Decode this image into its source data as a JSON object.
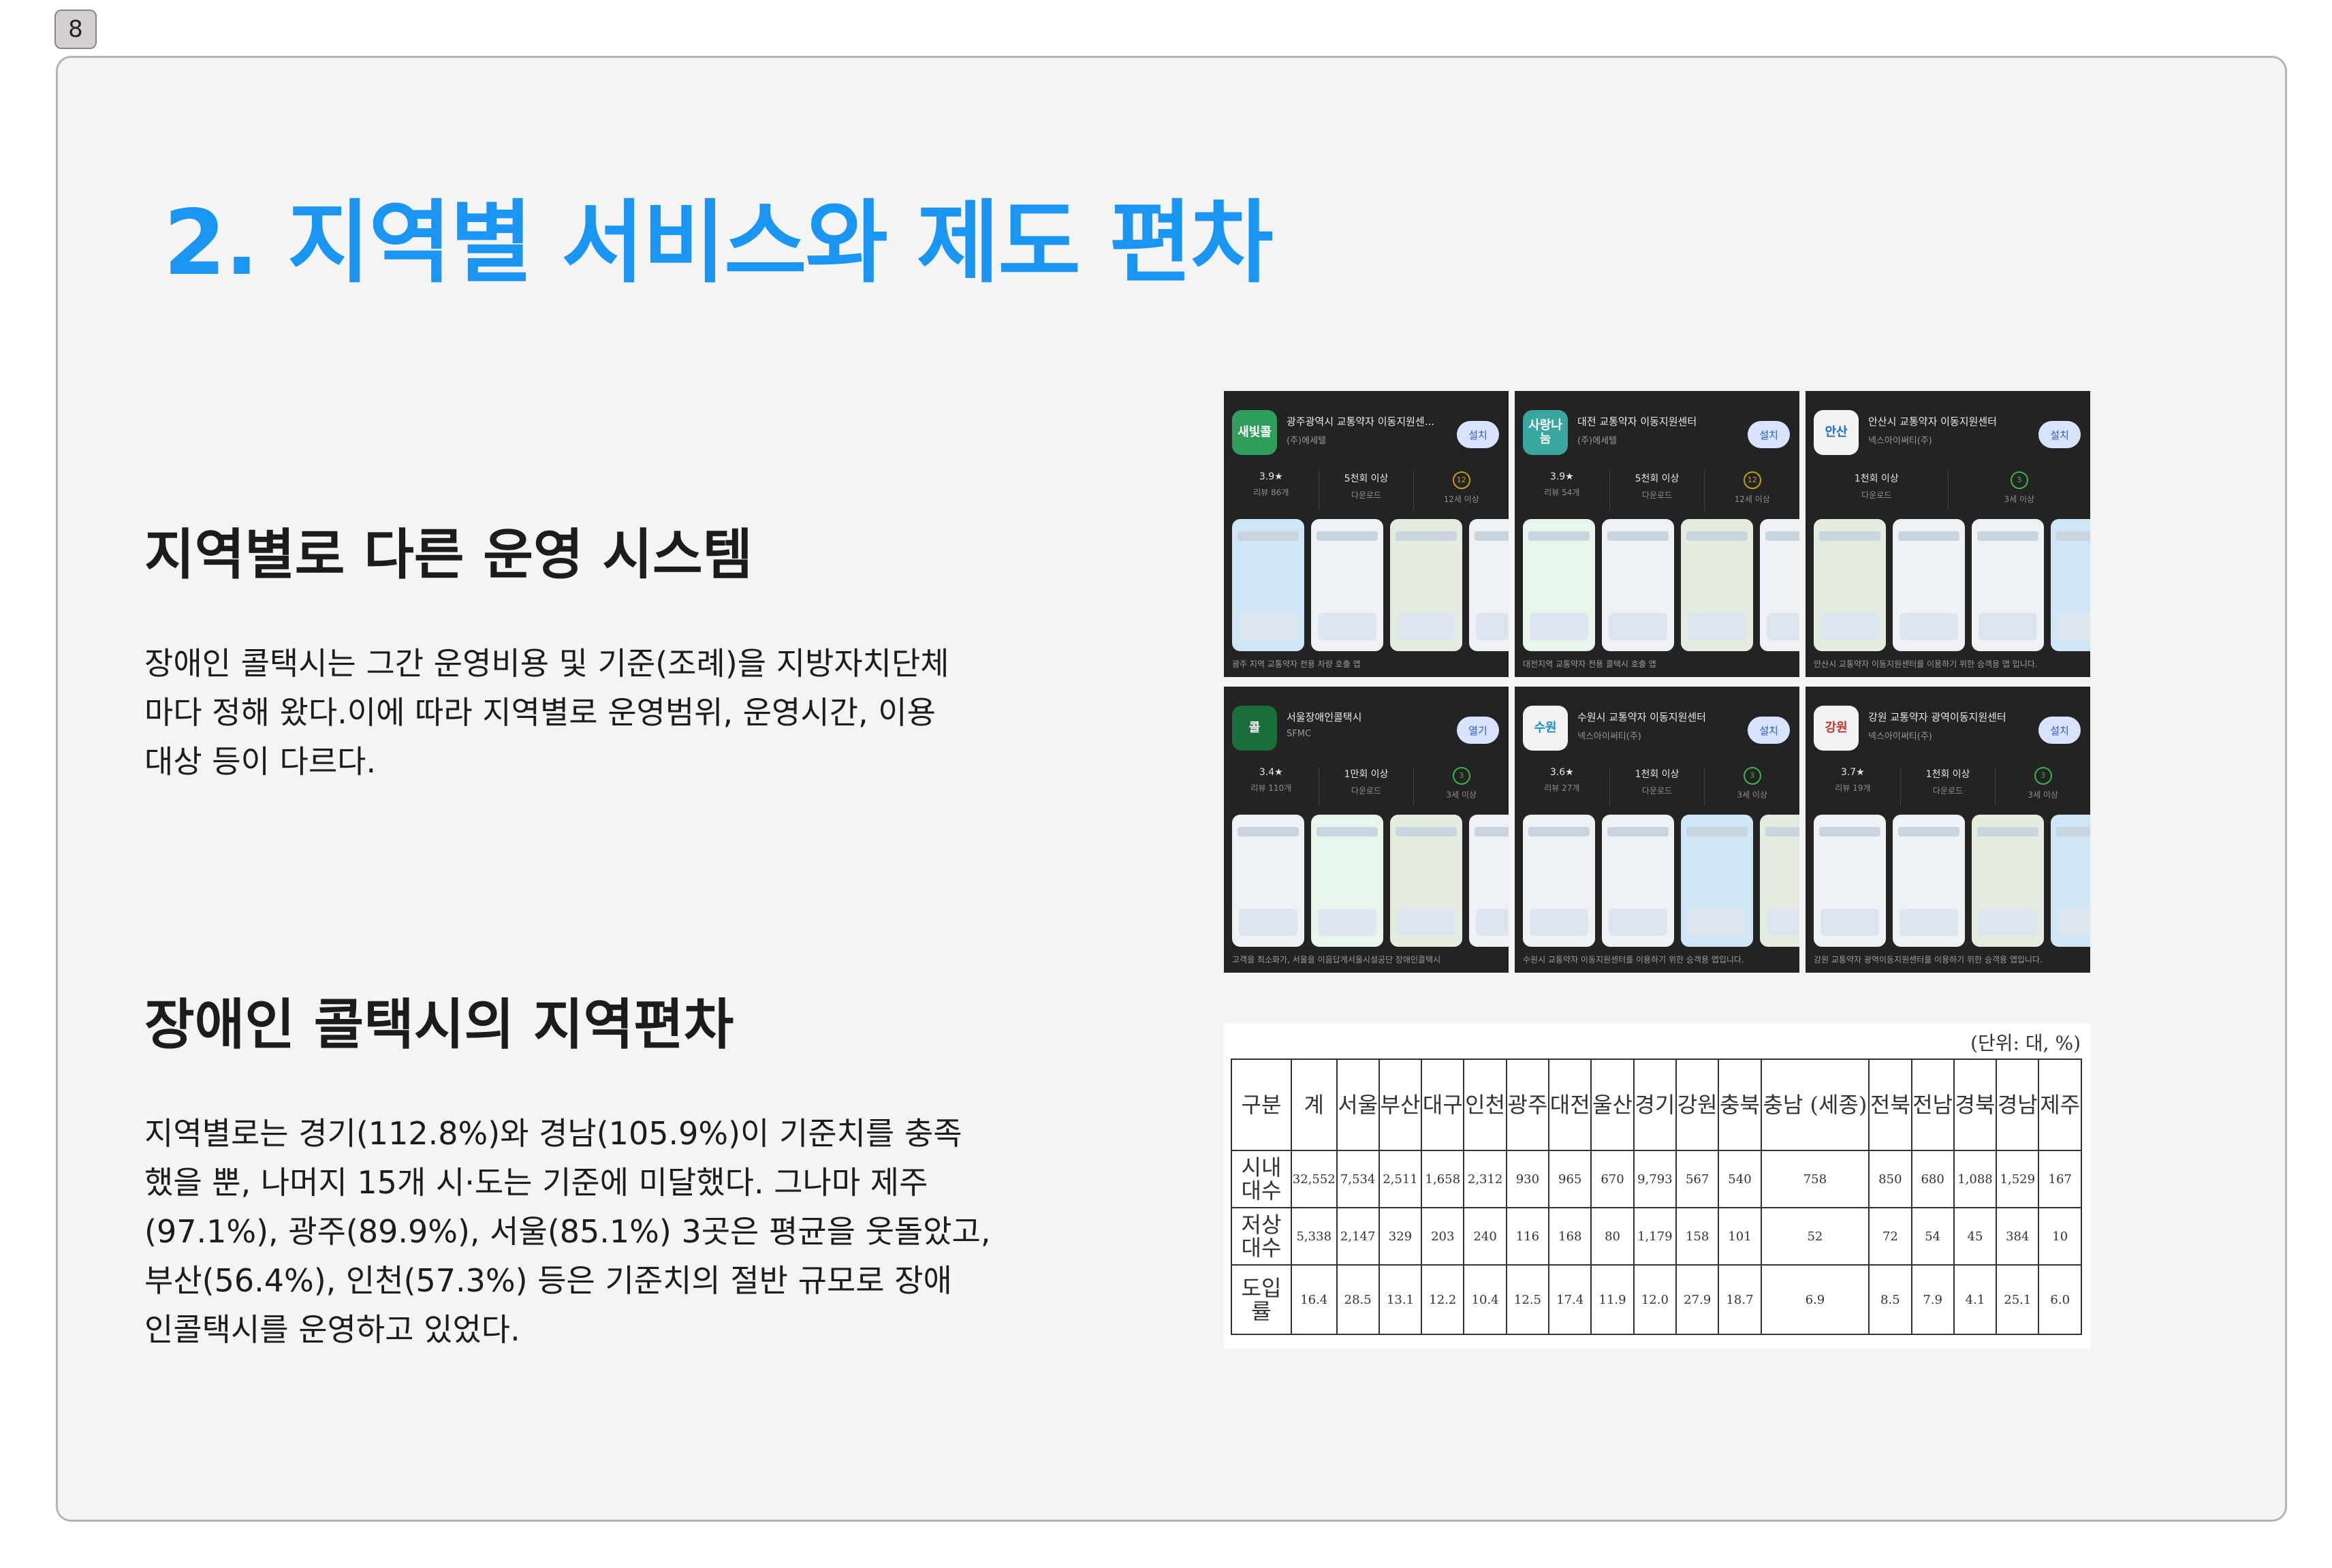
{
  "page_number": "8",
  "title": "2. 지역별 서비스와 제도 편차",
  "section1": {
    "heading": "지역별로 다른 운영 시스템",
    "lines": [
      "장애인 콜택시는 그간 운영비용 및 기준(조례)을 지방자치단체",
      "마다 정해 왔다.이에 따라 지역별로 운영범위, 운영시간, 이용",
      "대상 등이 다르다."
    ]
  },
  "section2": {
    "heading": "장애인 콜택시의 지역편차",
    "lines": [
      "지역별로는 경기(112.8%)와 경남(105.9%)이 기준치를 충족",
      "했을 뿐, 나머지 15개 시·도는 기준에 미달했다. 그나마 제주",
      "(97.1%), 광주(89.9%), 서울(85.1%) 3곳은 평균을 웃돌았고,",
      "부산(56.4%), 인천(57.3%) 등은 기준치의 절반 규모로 장애",
      "인콜택시를 운영하고 있었다."
    ]
  },
  "apps": [
    {
      "name": "광주광역시 교통약자 이동지원센...",
      "developer": "(주)에세텔",
      "button": "설치",
      "icon_text": "새빛콜",
      "icon_color": "#2f9e5b",
      "rating": "3.9★",
      "rating_label": "리뷰 86개",
      "downloads": "5천회 이상",
      "downloads_label": "다운로드",
      "age": "12",
      "age_label": "12세 이상",
      "caption": "광주 지역 교통약자 전용 차량 호출 앱"
    },
    {
      "name": "대전 교통약자 이동지원센터",
      "developer": "(주)에세텔",
      "button": "설치",
      "icon_text": "사랑나눔",
      "icon_color": "#3aa6a0",
      "rating": "3.9★",
      "rating_label": "리뷰 54개",
      "downloads": "5천회 이상",
      "downloads_label": "다운로드",
      "age": "12",
      "age_label": "12세 이상",
      "caption": "대전지역 교통약자 전용 콜택시 호출 앱"
    },
    {
      "name": "안산시 교통약자 이동지원센터",
      "developer": "넥스아이써티(주)",
      "button": "설치",
      "icon_text": "안산",
      "icon_color": "#f2f2f2",
      "rating": "1천회 이상",
      "rating_label": "다운로드",
      "downloads": "",
      "downloads_label": "",
      "age": "3",
      "age_label": "3세 이상",
      "caption": "안산시 교통약자 이동지원센터를 이용하기 위한 승객용 앱 입니다."
    },
    {
      "name": "서울장애인콜택시",
      "developer": "SFMC",
      "button": "열기",
      "icon_text": "콜",
      "icon_color": "#1a6e3a",
      "rating": "3.4★",
      "rating_label": "리뷰 110개",
      "downloads": "1만회 이상",
      "downloads_label": "다운로드",
      "age": "3",
      "age_label": "3세 이상",
      "caption": "고객을 최소화가, 서울을 이음답게서울시설공단 장애인콜택시"
    },
    {
      "name": "수원시 교통약자 이동지원센터",
      "developer": "넥스아이써티(주)",
      "button": "설치",
      "icon_text": "수원",
      "icon_color": "#f2f2f2",
      "rating": "3.6★",
      "rating_label": "리뷰 27개",
      "downloads": "1천회 이상",
      "downloads_label": "다운로드",
      "age": "3",
      "age_label": "3세 이상",
      "caption": "수원시 교통약자 이동지원센터를 이용하기 위한 승객용 앱입니다."
    },
    {
      "name": "강원 교통약자 광역이동지원센터",
      "developer": "넥스아이써티(주)",
      "button": "설치",
      "icon_text": "강원",
      "icon_color": "#f2f2f2",
      "rating": "3.7★",
      "rating_label": "리뷰 19개",
      "downloads": "1천회 이상",
      "downloads_label": "다운로드",
      "age": "3",
      "age_label": "3세 이상",
      "caption": "강원 교통약자 광역이동지원센터를 이용하기 위한 승객용 앱입니다."
    }
  ],
  "table": {
    "unit": "(단위: 대, %)",
    "headers": [
      "구분",
      "계",
      "서울",
      "부산",
      "대구",
      "인천",
      "광주",
      "대전",
      "울산",
      "경기",
      "강원",
      "충북",
      "충남 (세종)",
      "전북",
      "전남",
      "경북",
      "경남",
      "제주"
    ],
    "rows": [
      {
        "label": "시내 대수",
        "values": [
          "32,552",
          "7,534",
          "2,511",
          "1,658",
          "2,312",
          "930",
          "965",
          "670",
          "9,793",
          "567",
          "540",
          "758",
          "850",
          "680",
          "1,088",
          "1,529",
          "167"
        ]
      },
      {
        "label": "저상 대수",
        "values": [
          "5,338",
          "2,147",
          "329",
          "203",
          "240",
          "116",
          "168",
          "80",
          "1,179",
          "158",
          "101",
          "52",
          "72",
          "54",
          "45",
          "384",
          "10"
        ]
      },
      {
        "label": "도입 률",
        "values": [
          "16.4",
          "28.5",
          "13.1",
          "12.2",
          "10.4",
          "12.5",
          "17.4",
          "11.9",
          "12.0",
          "27.9",
          "18.7",
          "6.9",
          "8.5",
          "7.9",
          "4.1",
          "25.1",
          "6.0"
        ]
      }
    ]
  }
}
